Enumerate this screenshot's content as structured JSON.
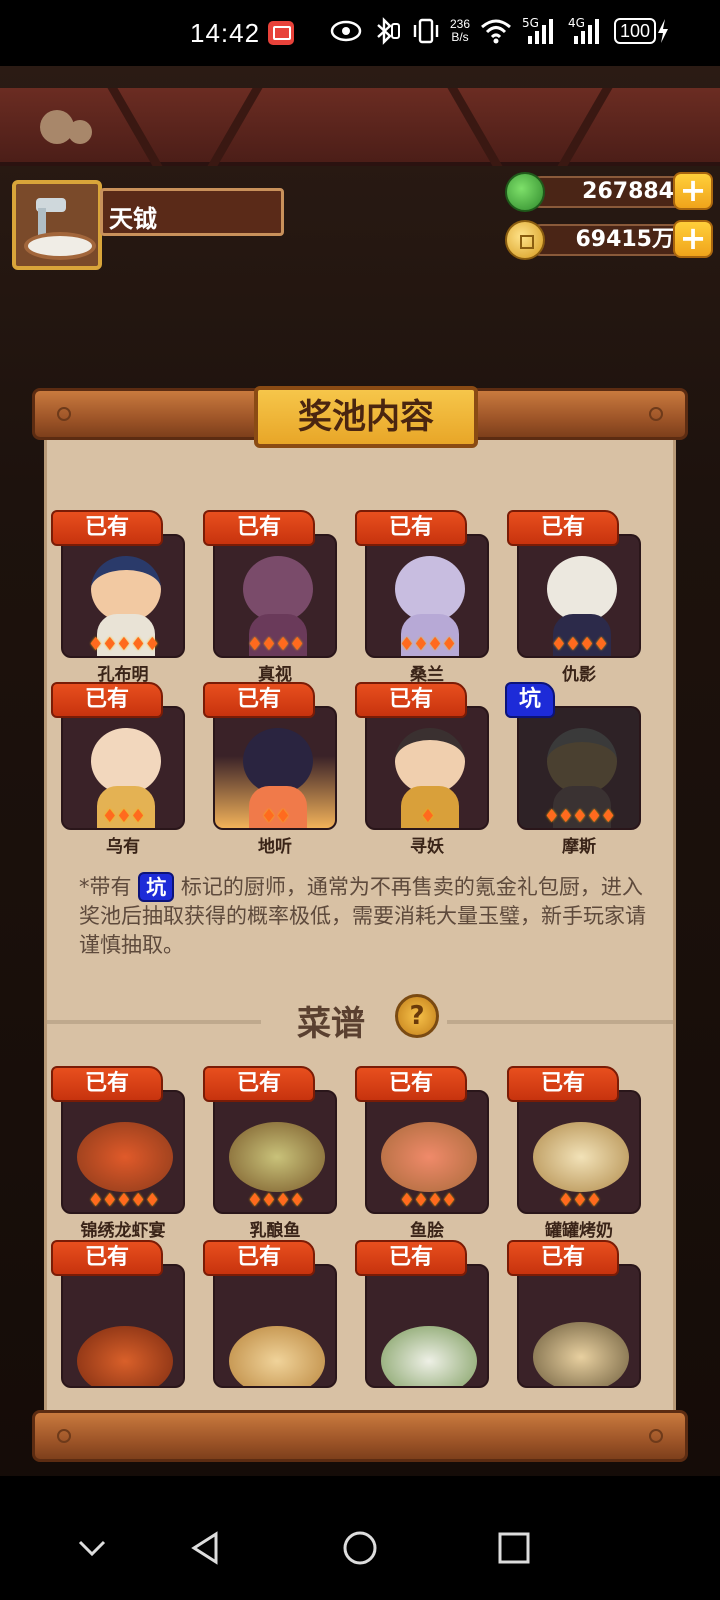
{
  "status_bar": {
    "time": "14:42",
    "net_speed_value": "236",
    "net_speed_unit": "B/s",
    "signal_1": "5G",
    "signal_2": "4G",
    "battery": "100"
  },
  "player": {
    "name": "天钺"
  },
  "currency": {
    "jade": "267884",
    "coins": "69415万",
    "plus_label": "+"
  },
  "panel": {
    "title": "奖池内容"
  },
  "chefs": [
    {
      "name": "孔布明",
      "tag": "已有",
      "stars": 5
    },
    {
      "name": "真视",
      "tag": "已有",
      "stars": 4
    },
    {
      "name": "桑兰",
      "tag": "已有",
      "stars": 4
    },
    {
      "name": "仇影",
      "tag": "已有",
      "stars": 4
    },
    {
      "name": "乌有",
      "tag": "已有",
      "stars": 3
    },
    {
      "name": "地听",
      "tag": "已有",
      "stars": 2
    },
    {
      "name": "寻妖",
      "tag": "已有",
      "stars": 1
    },
    {
      "name": "摩斯",
      "tag": "坑",
      "stars": 5
    }
  ],
  "note": {
    "prefix": "*带有",
    "tag": "坑",
    "text": "标记的厨师，通常为不再售卖的氪金礼包厨，进入奖池后抽取获得的概率极低，需要消耗大量玉璧，新手玩家请谨慎抽取。"
  },
  "recipes_section": {
    "title": "菜谱",
    "help": "?"
  },
  "recipes": [
    {
      "name": "锦绣龙虾宴",
      "tag": "已有",
      "stars": 5
    },
    {
      "name": "乳酿鱼",
      "tag": "已有",
      "stars": 4
    },
    {
      "name": "鱼脍",
      "tag": "已有",
      "stars": 4
    },
    {
      "name": "罐罐烤奶",
      "tag": "已有",
      "stars": 3
    },
    {
      "name": "",
      "tag": "已有",
      "stars": 0
    },
    {
      "name": "",
      "tag": "已有",
      "stars": 0
    },
    {
      "name": "",
      "tag": "已有",
      "stars": 0
    },
    {
      "name": "",
      "tag": "已有",
      "stars": 0
    }
  ],
  "colors": {
    "tag_owned": "#d9401a",
    "tag_pit": "#1d2bd8",
    "panel": "#d8c1a4",
    "frame_gold": "#e8a628"
  },
  "icons": {
    "back": "triangle-left",
    "home": "circle",
    "recents": "square",
    "collapse": "chevron-down"
  }
}
